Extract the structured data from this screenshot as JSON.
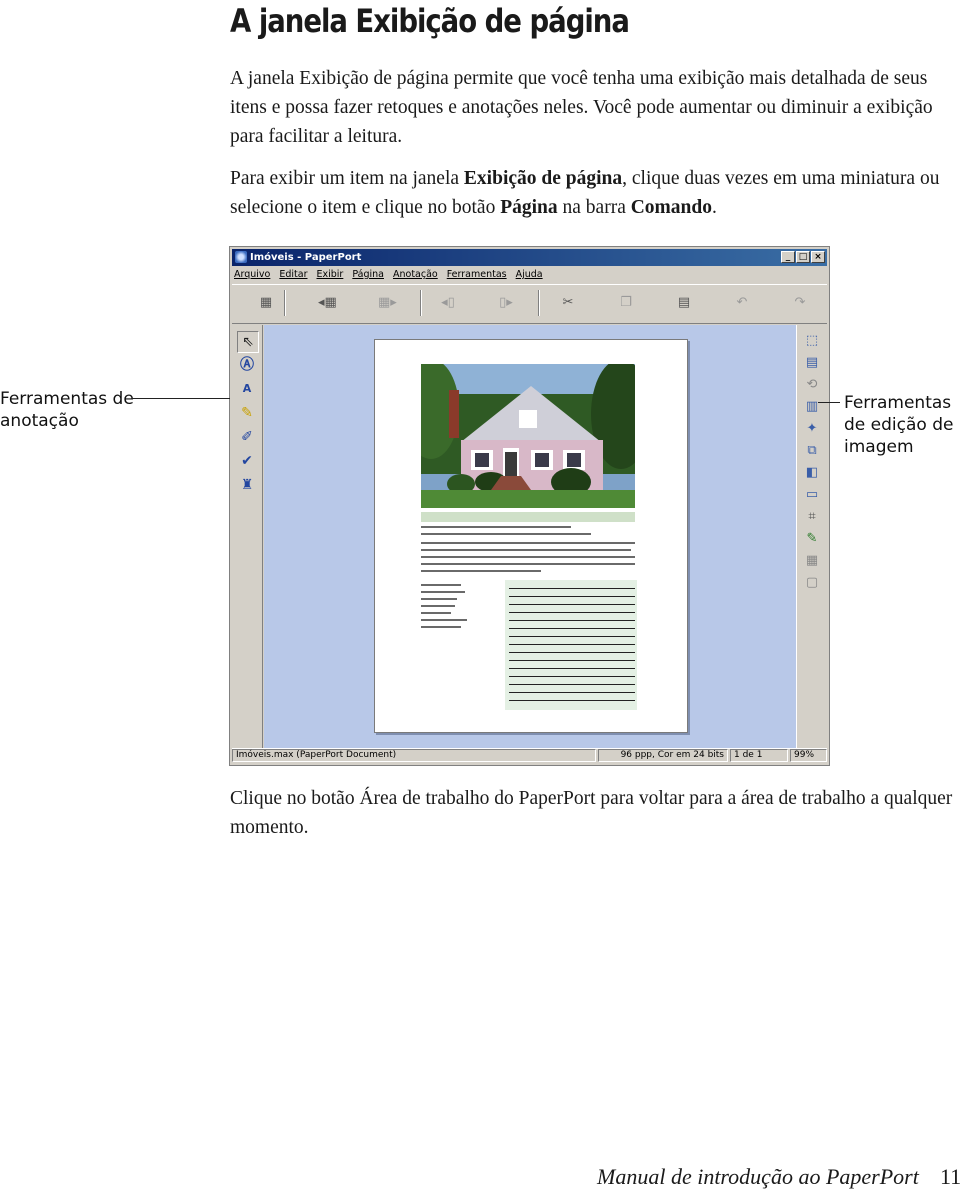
{
  "heading": "A janela Exibição de página",
  "intro_paragraph": "A janela Exibição de página permite que você tenha uma exibição mais detalhada de seus itens e possa fazer retoques e anotações neles. Você pode aumentar ou diminuir a exibição para facilitar a leitura.",
  "instruction": {
    "t1": "Para exibir um item na janela ",
    "b1": "Exibição de página",
    "t2": ", clique duas vezes em uma miniatura ou selecione o item e clique no botão ",
    "b2": "Página",
    "t3": " na barra ",
    "b3": "Comando",
    "t4": "."
  },
  "window": {
    "title": "Imóveis - PaperPort",
    "controls": [
      "_",
      "□",
      "×"
    ],
    "menu": [
      "Arquivo",
      "Editar",
      "Exibir",
      "Página",
      "Anotação",
      "Ferramentas",
      "Ajuda"
    ],
    "toolbar_icons": [
      "thumbnail-view-icon",
      "previous-page-icon",
      "next-page-icon",
      "page-back-icon",
      "page-forward-icon",
      "cut-icon",
      "copy-icon",
      "paste-icon",
      "undo-icon",
      "redo-icon"
    ],
    "annotation_tools": [
      "pointer-icon",
      "note-icon",
      "text-icon",
      "highlighter-icon",
      "freehand-pen-icon",
      "checkmark-icon",
      "stamp-icon"
    ],
    "image_tools": [
      "select-area-icon",
      "fit-page-icon",
      "rotate-icon",
      "fit-width-icon",
      "enhance-icon",
      "zoom-icon",
      "straighten-icon",
      "scale-icon",
      "crop-icon",
      "color-icon",
      "grid-icon",
      "page-layout-icon"
    ],
    "status": {
      "file": "Imóveis.max (PaperPort Document)",
      "resolution": "96 ppp, Cor em 24 bits",
      "page": "1 de 1",
      "zoom": "99%"
    }
  },
  "callouts": {
    "annotation_tools": [
      "Ferramentas de",
      "anotação"
    ],
    "image_tools": [
      "Ferramentas",
      "de edição de",
      "imagem"
    ]
  },
  "closing_paragraph": "Clique no botão Área de trabalho do PaperPort para voltar para a área de trabalho a qualquer momento.",
  "footer": {
    "title": "Manual de introdução ao PaperPort",
    "page_number": "11"
  }
}
